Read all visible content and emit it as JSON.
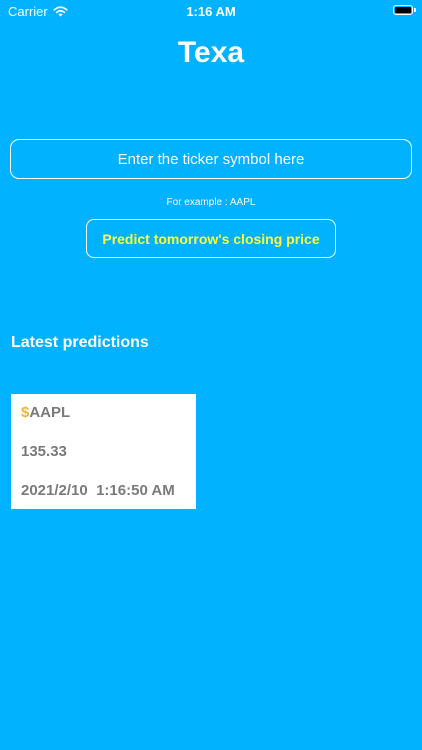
{
  "status_bar": {
    "carrier": "Carrier",
    "time": "1:16 AM",
    "icons": [
      "wifi-icon",
      "battery-icon"
    ]
  },
  "app": {
    "title": "Texa"
  },
  "search": {
    "placeholder": "Enter the ticker symbol here",
    "value": "",
    "hint": "For example : AAPL"
  },
  "predict": {
    "label": "Predict tomorrow's closing price"
  },
  "latest": {
    "title": "Latest predictions",
    "items": [
      {
        "currency": "$",
        "ticker": "AAPL",
        "price": "135.33",
        "date": "2021/2/10",
        "time": "1:16:50 AM"
      }
    ]
  },
  "colors": {
    "background": "#00b2ff",
    "button_text": "#ffff33",
    "dollar": "#f2b632",
    "card_text": "#7a7a7a"
  }
}
